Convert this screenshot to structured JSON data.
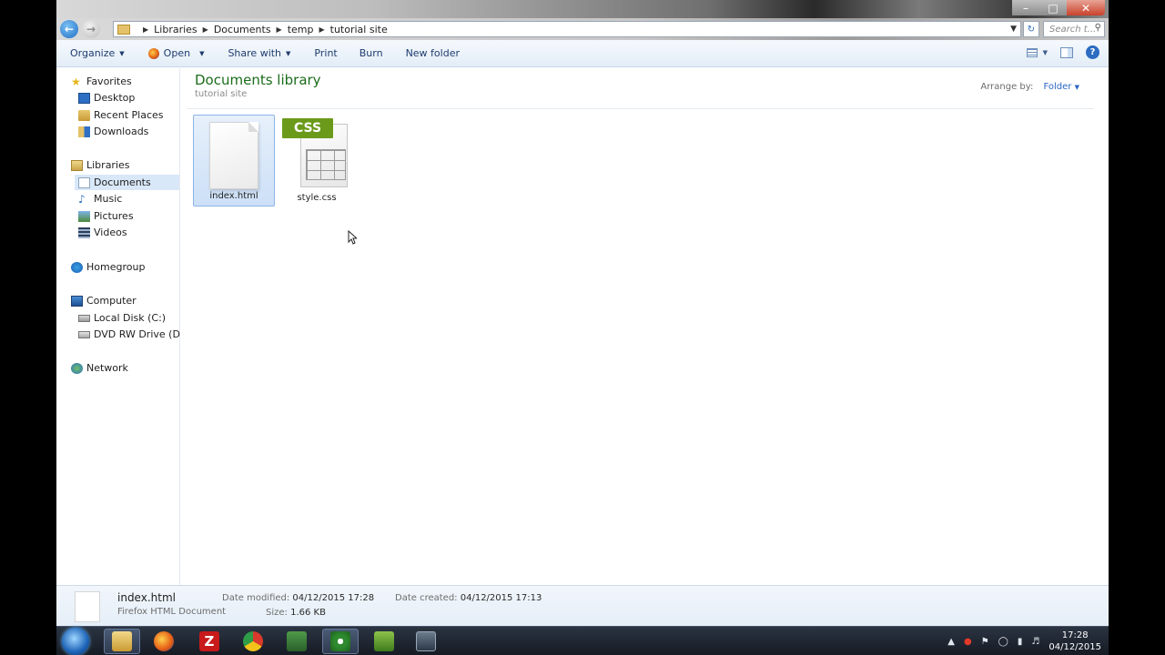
{
  "address": {
    "crumbs": [
      "Libraries",
      "Documents",
      "temp",
      "tutorial site"
    ],
    "search_placeholder": "Search t..."
  },
  "toolbar": {
    "organize": "Organize",
    "open": "Open",
    "share_with": "Share with",
    "print": "Print",
    "burn": "Burn",
    "new_folder": "New folder"
  },
  "sidebar": {
    "favorites": "Favorites",
    "desktop": "Desktop",
    "recent_places": "Recent Places",
    "downloads": "Downloads",
    "libraries": "Libraries",
    "documents": "Documents",
    "music": "Music",
    "pictures": "Pictures",
    "videos": "Videos",
    "homegroup": "Homegroup",
    "computer": "Computer",
    "local_disk": "Local Disk (C:)",
    "dvd_drive": "DVD RW Drive (D:) C",
    "network": "Network"
  },
  "content": {
    "title": "Documents library",
    "subtitle": "tutorial site",
    "arrange_label": "Arrange by:",
    "arrange_value": "Folder",
    "files": [
      {
        "name": "index.html"
      },
      {
        "name": "style.css",
        "badge": "CSS"
      }
    ]
  },
  "details": {
    "name": "index.html",
    "type": "Firefox HTML Document",
    "modified_label": "Date modified:",
    "modified_value": "04/12/2015 17:28",
    "created_label": "Date created:",
    "created_value": "04/12/2015 17:13",
    "size_label": "Size:",
    "size_value": "1.66 KB"
  },
  "taskbar": {
    "time": "17:28",
    "date": "04/12/2015"
  }
}
